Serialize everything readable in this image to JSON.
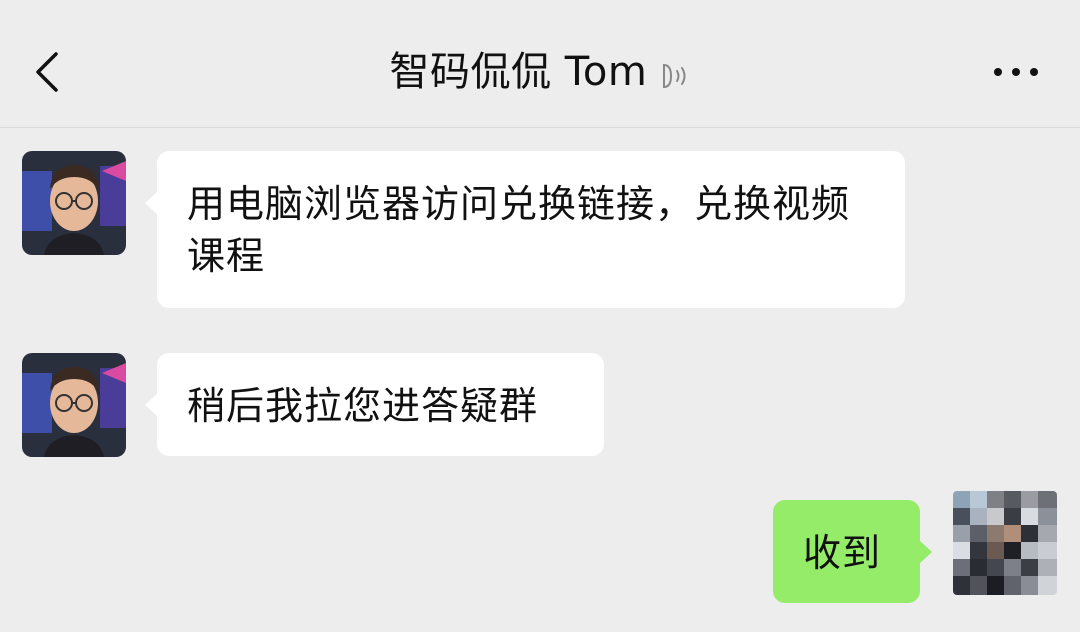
{
  "header": {
    "title": "智码侃侃 Tom",
    "back_icon": "chevron-left-icon",
    "voice_icon": "voice-muted-icon",
    "more_icon": "more-dots-icon"
  },
  "messages": [
    {
      "side": "left",
      "sender_avatar": "avatar-tom",
      "text": "用电脑浏览器访问兑换链接，兑换视频课程"
    },
    {
      "side": "left",
      "sender_avatar": "avatar-tom",
      "text": "稍后我拉您进答疑群"
    },
    {
      "side": "right",
      "sender_avatar": "avatar-self-pixelated",
      "text": "收到"
    }
  ],
  "colors": {
    "background": "#ededed",
    "incoming_bubble": "#ffffff",
    "outgoing_bubble": "#95ec69"
  }
}
